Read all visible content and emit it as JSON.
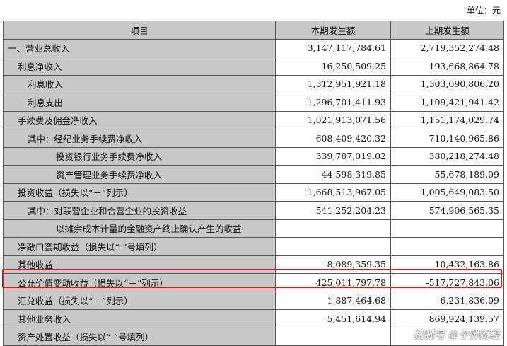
{
  "unit_label": "单位：元",
  "table": {
    "headers": [
      "项目",
      "本期发生额",
      "上期发生额"
    ],
    "rows": [
      {
        "label": "一、营业总收入",
        "indent": 0,
        "current": "3,147,117,784.61",
        "prior": "2,719,352,274.48"
      },
      {
        "label": "利息净收入",
        "indent": 1,
        "current": "16,250,509.25",
        "prior": "193,668,864.78"
      },
      {
        "label": "利息收入",
        "indent": 2,
        "current": "1,312,951,921.18",
        "prior": "1,303,090,806.20"
      },
      {
        "label": "利息支出",
        "indent": 2,
        "current": "1,296,701,411.93",
        "prior": "1,109,421,941.42"
      },
      {
        "label": "手续费及佣金净收入",
        "indent": 1,
        "current": "1,021,913,071.56",
        "prior": "1,151,174,029.74"
      },
      {
        "label": "其中：经纪业务手续费净收入",
        "indent": 2,
        "current": "608,409,420.32",
        "prior": "710,140,965.86"
      },
      {
        "label": "投资银行业务手续费净收入",
        "indent": 3,
        "current": "339,787,019.02",
        "prior": "380,218,274.48"
      },
      {
        "label": "资产管理业务手续费净收入",
        "indent": 3,
        "current": "44,598,319.85",
        "prior": "55,678,189.09"
      },
      {
        "label": "投资收益（损失以“－”列示）",
        "indent": 1,
        "current": "1,668,513,967.05",
        "prior": "1,005,649,083.50"
      },
      {
        "label": "其中：对联营企业和合营企业的投资收益",
        "indent": 2,
        "current": "541,252,204.23",
        "prior": "574,906,565.35"
      },
      {
        "label": "以摊余成本计量的金融资产终止确认产生的收益",
        "indent": 3,
        "current": "",
        "prior": ""
      },
      {
        "label": "净敞口套期收益（损失以“-”号填列）",
        "indent": 1,
        "current": "",
        "prior": ""
      },
      {
        "label": "其他收益",
        "indent": 1,
        "current": "8,089,359.35",
        "prior": "10,432,163.86"
      },
      {
        "label": "公允价值变动收益（损失以“－”列示）",
        "indent": 1,
        "current": "425,011,797.78",
        "prior": "-517,727,843.06"
      },
      {
        "label": "汇兑收益（损失以“－”列示）",
        "indent": 1,
        "current": "1,887,464.68",
        "prior": "6,231,836.09"
      },
      {
        "label": "其他业务收入",
        "indent": 1,
        "current": "5,451,614.94",
        "prior": "869,924,139.57"
      },
      {
        "label": "资产处置收益（损失以“-”号填列）",
        "indent": 1,
        "current": "",
        "prior": ""
      }
    ]
  },
  "highlight_color": "#e3140f",
  "watermark": "搜狐号 @子弹财经"
}
